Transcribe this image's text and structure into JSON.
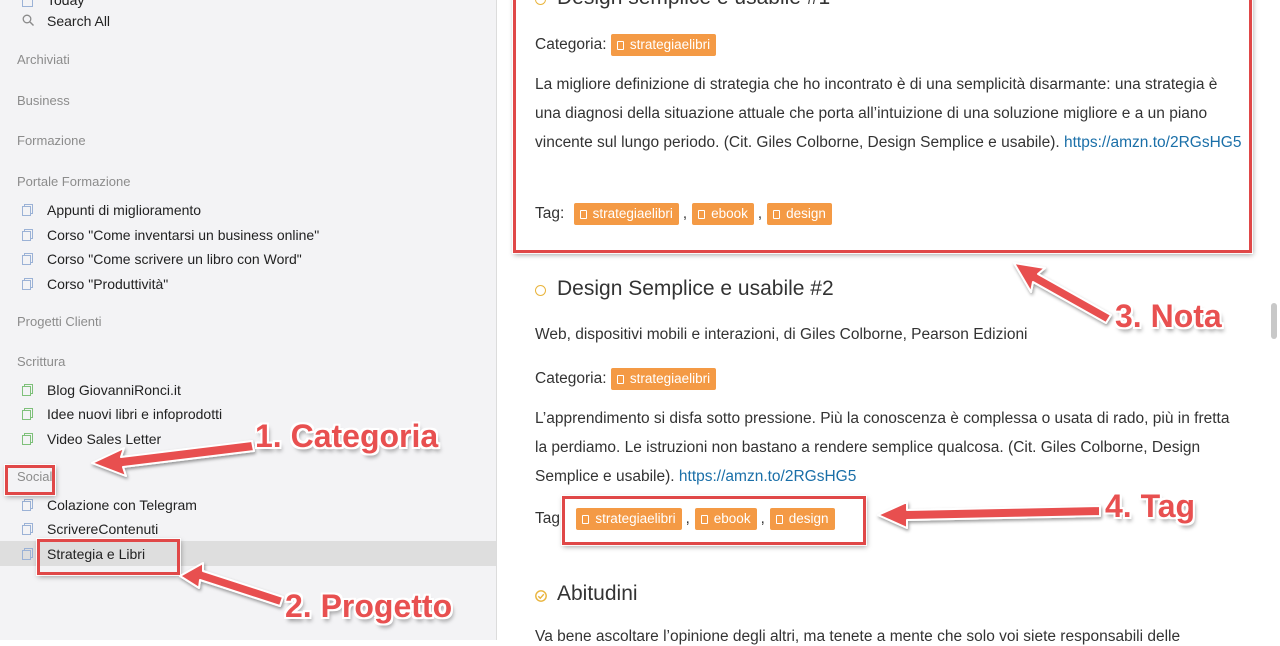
{
  "sidebar": {
    "today": "Today",
    "search_all": "Search All",
    "headers": [
      "Archiviati",
      "Business",
      "Formazione",
      "Portale Formazione",
      "Progetti Clienti",
      "Scrittura",
      "Social"
    ],
    "portale_items": [
      "Appunti di miglioramento",
      "Corso \"Come inventarsi un business online\"",
      "Corso \"Come scrivere un libro con Word\"",
      "Corso \"Produttività\""
    ],
    "scrittura_items": [
      "Blog GiovanniRonci.it",
      "Idee nuovi libri e infoprodotti",
      "Video Sales Letter"
    ],
    "social_items": [
      "Colazione con Telegram",
      "ScrivereContenuti",
      "Strategia e Libri"
    ]
  },
  "notes": {
    "note1": {
      "title": "Design semplice e usabile #1",
      "category_label": "Categoria:",
      "category": "strategiaelibri",
      "body": "La migliore definizione di strategia che ho incontrato è di una semplicità disarmante: una strategia è una diagnosi della situazione attuale che porta all’intuizione di una soluzione migliore e a un piano vincente sul lungo periodo. (Cit. Giles Colborne, Design Semplice e usabile).",
      "link": "https://amzn.to/2RGsHG5",
      "tag_label": "Tag:",
      "tags": [
        "strategiaelibri",
        "ebook",
        "design"
      ]
    },
    "note2": {
      "title": "Design Semplice e usabile #2",
      "subtitle": "Web, dispositivi mobili e interazioni, di Giles Colborne, Pearson Edizioni",
      "category_label": "Categoria:",
      "category": "strategiaelibri",
      "body": "L’apprendimento si disfa sotto pressione. Più la conoscenza è complessa o usata di rado, più in fretta la perdiamo. Le istruzioni non bastano a rendere semplice qualcosa. (Cit. Giles Colborne, Design Semplice e usabile).",
      "link": "https://amzn.to/2RGsHG5",
      "tag_label": "Tag",
      "tags": [
        "strategiaelibri",
        "ebook",
        "design"
      ]
    },
    "note3": {
      "title": "Abitudini",
      "body": "Va bene ascoltare l’opinione degli altri, ma tenete a mente che solo voi siete responsabili delle"
    }
  },
  "callouts": {
    "categoria": "1. Categoria",
    "progetto": "2. Progetto",
    "nota": "3. Nota",
    "tag": "4. Tag"
  },
  "colors": {
    "tag": "#f49a45",
    "annotation": "#e04848",
    "link": "#1a6fa8"
  }
}
